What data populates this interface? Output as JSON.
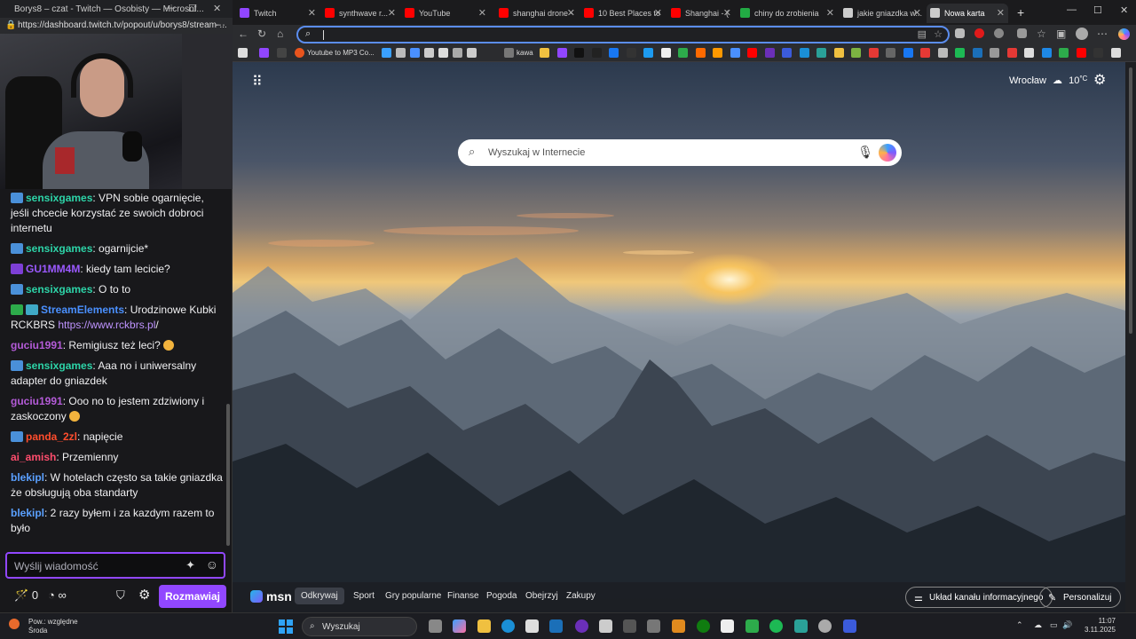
{
  "popout": {
    "title": "Borys8 – czat - Twitch — Osobisty — Microsof...",
    "url": "https://dashboard.twitch.tv/popout/u/borys8/stream-..."
  },
  "chat": {
    "messages": [
      {
        "user": "sensixgames",
        "color": "#2dd4a8",
        "text": ": VPN sobie ogarnięcie, jeśli chcecie korzystać ze swoich dobroci internetu"
      },
      {
        "user": "sensixgames",
        "color": "#2dd4a8",
        "text": ": ogarnijcie*"
      },
      {
        "user": "GU1MM4M",
        "color": "#9b59ff",
        "text": ": kiedy tam lecicie?"
      },
      {
        "user": "sensixgames",
        "color": "#2dd4a8",
        "text": ": O to to"
      },
      {
        "user": "StreamElements",
        "color": "#4a90ff",
        "text": ": Urodzinowe Kubki RCKBRS ",
        "link": "https://www.rckbrs.pl",
        "after": "/"
      },
      {
        "user": "guciu1991",
        "color": "#b45bd8",
        "text": ": Remigiusz też leci? "
      },
      {
        "user": "sensixgames",
        "color": "#2dd4a8",
        "text": ": Aaa no i uniwersalny adapter do gniazdek"
      },
      {
        "user": "guciu1991",
        "color": "#b45bd8",
        "text": ": Ooo no to jestem zdziwiony i zaskoczony "
      },
      {
        "user": "panda_2zl",
        "color": "#ff4d2d",
        "text": ": napięcie"
      },
      {
        "user": "ai_amish",
        "color": "#ff4d6d",
        "text": ": Przemienny"
      },
      {
        "user": "blekipl",
        "color": "#5aa0ff",
        "text": ": W hotelach często sa takie gniazdka że obsługują oba standarty"
      },
      {
        "user": "blekipl",
        "color": "#5aa0ff",
        "text": ": 2 razy byłem i za kazdym razem to było"
      }
    ],
    "input_placeholder": "Wyślij wiadomość",
    "points": "0",
    "infinity": "∞",
    "send_button": "Rozmawiaj"
  },
  "tabs": [
    {
      "label": "Twitch",
      "color": "#9146ff"
    },
    {
      "label": "synthwave r...",
      "color": "#ff0000"
    },
    {
      "label": "YouTube",
      "color": "#ff0000"
    },
    {
      "label": "shanghai drone ·",
      "color": "#ff0000"
    },
    {
      "label": "10 Best Places to",
      "color": "#ff0000"
    },
    {
      "label": "Shanghai - (",
      "color": "#ff0000"
    },
    {
      "label": "chiny do zrobienia",
      "color": "#22aa44"
    },
    {
      "label": "jakie gniazdka w...",
      "color": "#cccccc"
    },
    {
      "label": "Nowa karta",
      "color": "#cccccc"
    }
  ],
  "bookmarks": {
    "youtube_mp3": "Youtube to MP3 Co...",
    "kawa": "kawa"
  },
  "newtab": {
    "weather_city": "Wrocław",
    "weather_temp": "10",
    "weather_unit": "°C",
    "search_placeholder": "Wyszukaj w Internecie"
  },
  "msn": {
    "logo": "msn",
    "nav": [
      "Odkrywaj",
      "Sport",
      "Gry popularne",
      "Finanse",
      "Pogoda",
      "Obejrzyj",
      "Zakupy"
    ],
    "feed_layout": "Układ kanału informacyjnego",
    "personalize": "Personalizuj"
  },
  "taskbar": {
    "weather_line1": "Pow.: względne",
    "weather_line2": "Środa",
    "search": "Wyszukaj",
    "time": "11:07",
    "date": "3.11.2025"
  }
}
